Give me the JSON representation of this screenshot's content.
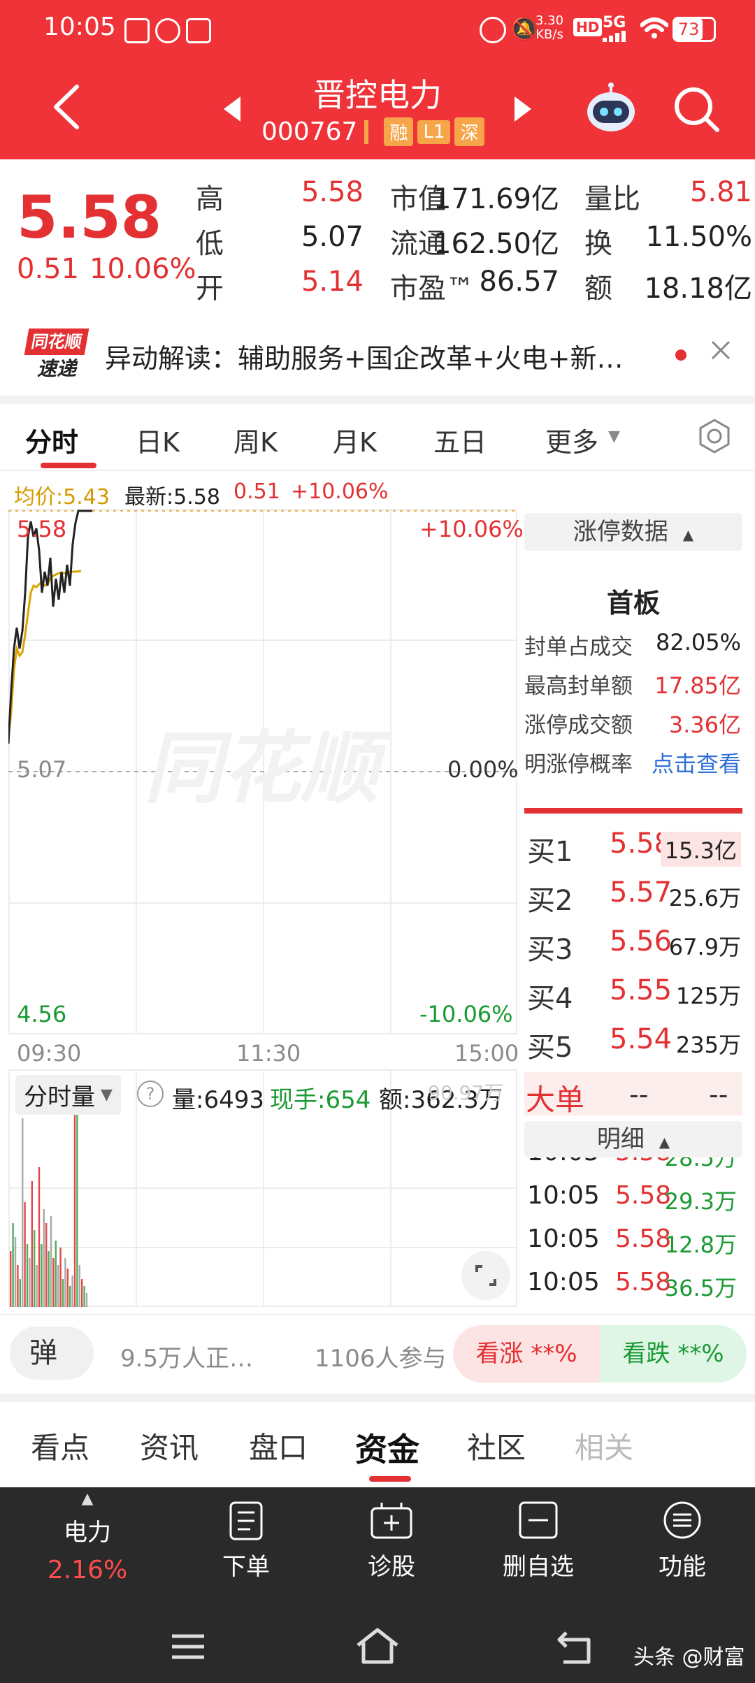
{
  "status_bar": {
    "time": "10:05",
    "net_speed_top": "3.30",
    "net_speed_bottom": "KB/s",
    "signal": "5G",
    "battery": "73"
  },
  "header": {
    "stock_name": "晋控电力",
    "stock_code": "000767",
    "badges": [
      "融",
      "L1",
      "深"
    ]
  },
  "quote": {
    "price": "5.58",
    "change": "0.51",
    "change_pct": "10.06%",
    "rows": [
      [
        {
          "label": "高",
          "value": "5.58",
          "color": "red"
        },
        {
          "label": "市值",
          "value": "171.69亿"
        },
        {
          "label": "量比",
          "value": "5.81",
          "color": "red"
        }
      ],
      [
        {
          "label": "低",
          "value": "5.07"
        },
        {
          "label": "流通",
          "value": "162.50亿"
        },
        {
          "label": "换",
          "value": "11.50%"
        }
      ],
      [
        {
          "label": "开",
          "value": "5.14",
          "color": "red"
        },
        {
          "label": "市盈™",
          "value": "86.57"
        },
        {
          "label": "额",
          "value": "18.18亿"
        }
      ]
    ]
  },
  "news": {
    "logo_top": "同花顺",
    "logo_bottom": "速递",
    "text": "异动解读：辅助服务+国企改革+火电+新…"
  },
  "chart_tabs": [
    "分时",
    "日K",
    "周K",
    "月K",
    "五日",
    "更多"
  ],
  "info_line": {
    "avg_label": "均价:5.43",
    "latest_label": "最新:5.58",
    "change": "0.51",
    "pct": "+10.06%"
  },
  "chart_labels": {
    "high": "5.58",
    "high_pct": "+10.06%",
    "mid": "5.07",
    "mid_pct": "0.00%",
    "low": "4.56",
    "low_pct": "-10.06%",
    "watermark": "同花顺",
    "time_start": "09:30",
    "time_mid": "11:30",
    "time_end": "15:00"
  },
  "volume_bar": {
    "selector": "分时量",
    "vol": "量:6493",
    "now": "现手:654",
    "amount": "额:362.3万",
    "overlay": "90.97万"
  },
  "limit_panel": {
    "title": "涨停数据",
    "board": "首板",
    "rows": [
      {
        "label": "封单占成交",
        "value": "82.05%",
        "color": "dark"
      },
      {
        "label": "最高封单额",
        "value": "17.85亿",
        "color": "red"
      },
      {
        "label": "涨停成交额",
        "value": "3.36亿",
        "color": "red"
      },
      {
        "label": "明涨停概率",
        "value": "点击查看",
        "color": "blue"
      }
    ]
  },
  "order_book": [
    {
      "label": "买1",
      "price": "5.58",
      "vol": "15.3亿"
    },
    {
      "label": "买2",
      "price": "5.57",
      "vol": "25.6万"
    },
    {
      "label": "买3",
      "price": "5.56",
      "vol": "67.9万"
    },
    {
      "label": "买4",
      "price": "5.55",
      "vol": "125万"
    },
    {
      "label": "买5",
      "price": "5.54",
      "vol": "235万"
    }
  ],
  "big_order": {
    "label": "大单",
    "v1": "--",
    "v2": "--"
  },
  "detail": {
    "title": "明细",
    "rows": [
      {
        "time": "10:05",
        "price": "5.58",
        "vol": "28.5万"
      },
      {
        "time": "10:05",
        "price": "5.58",
        "vol": "29.3万"
      },
      {
        "time": "10:05",
        "price": "5.58",
        "vol": "12.8万"
      },
      {
        "time": "10:05",
        "price": "5.58",
        "vol": "36.5万"
      }
    ]
  },
  "sentiment": {
    "danmu": "弹",
    "people": "9.5万人正…",
    "participants": "1106人参与",
    "bull": "看涨 **%",
    "bear": "看跌 **%"
  },
  "bottom_tabs": [
    "看点",
    "资讯",
    "盘口",
    "资金",
    "社区",
    "相关"
  ],
  "bottom_nav": {
    "sector": "电力",
    "sector_pct": "2.16%",
    "items": [
      "下单",
      "诊股",
      "删自选",
      "功能"
    ]
  },
  "watermark_bottom": "头条 @财富"
}
